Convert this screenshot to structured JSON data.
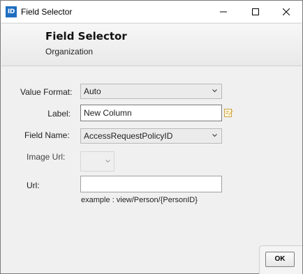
{
  "window": {
    "app_icon_text": "ID",
    "title": "Field Selector"
  },
  "header": {
    "title": "Field Selector",
    "subtitle": "Organization"
  },
  "form": {
    "value_format": {
      "label": "Value Format:",
      "value": "Auto"
    },
    "label": {
      "label": "Label:",
      "value": "New Column"
    },
    "field_name": {
      "label": "Field Name:",
      "value": "AccessRequestPolicyID"
    },
    "image_url": {
      "label": "Image Url:",
      "value": ""
    },
    "url": {
      "label": "Url:",
      "value": "",
      "example": "example : view/Person/{PersonID}"
    }
  },
  "footer": {
    "ok_label": "OK"
  },
  "colors": {
    "app_icon_bg": "#1f6fc1",
    "window_border": "#7a7a7a",
    "edit_icon": "#e0b040"
  }
}
